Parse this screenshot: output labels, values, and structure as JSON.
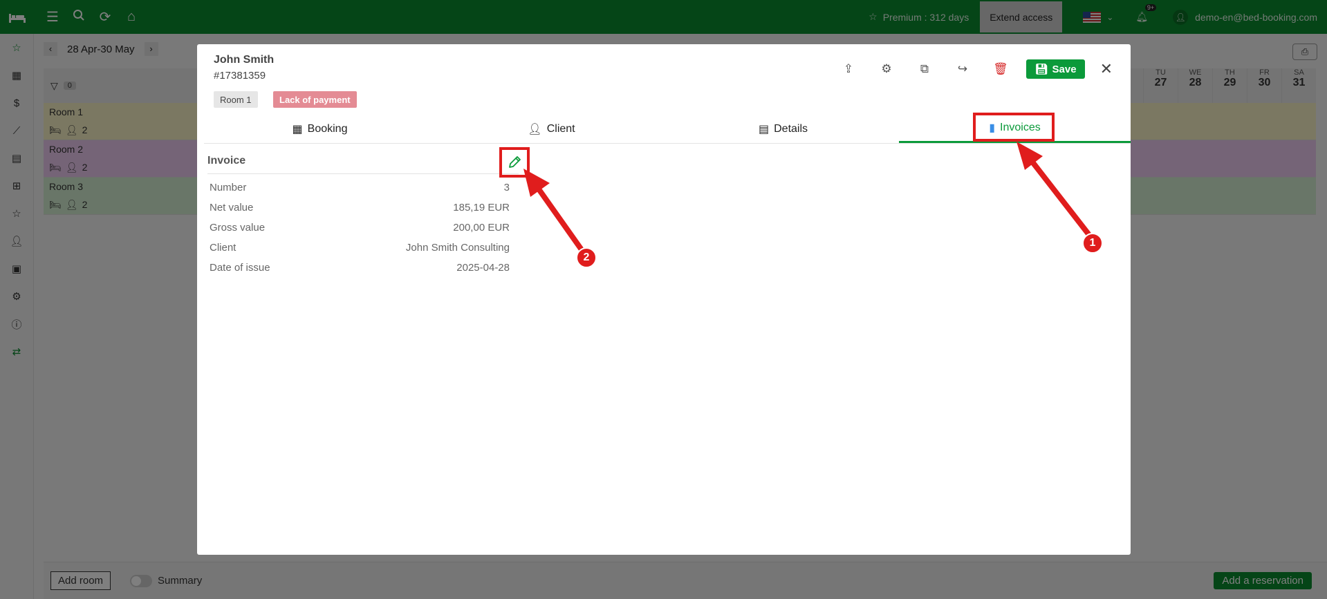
{
  "topbar": {
    "premium": "Premium : 312 days",
    "extend": "Extend access",
    "notif_badge": "9+",
    "user": "demo-en@bed-booking.com"
  },
  "calendar": {
    "range": "28 Apr-30 May",
    "filter_count": "0",
    "days": [
      {
        "dow": "TU",
        "num": "27"
      },
      {
        "dow": "WE",
        "num": "28"
      },
      {
        "dow": "TH",
        "num": "29"
      },
      {
        "dow": "FR",
        "num": "30"
      },
      {
        "dow": "SA",
        "num": "31"
      }
    ],
    "rooms": [
      {
        "name": "Room 1",
        "guests": "2"
      },
      {
        "name": "Room 2",
        "guests": "2"
      },
      {
        "name": "Room 3",
        "guests": "2"
      }
    ],
    "footer": {
      "add_room": "Add room",
      "summary": "Summary",
      "add_reservation": "Add a reservation"
    }
  },
  "modal": {
    "name": "John Smith",
    "id": "#17381359",
    "tag_room": "Room 1",
    "tag_status": "Lack of payment",
    "save": "Save",
    "tabs": [
      {
        "label": "Booking"
      },
      {
        "label": "Client"
      },
      {
        "label": "Details"
      },
      {
        "label": "Invoices"
      }
    ],
    "invoice": {
      "title": "Invoice",
      "rows": [
        {
          "label": "Number",
          "value": "3"
        },
        {
          "label": "Net value",
          "value": "185,19 EUR"
        },
        {
          "label": "Gross value",
          "value": "200,00 EUR"
        },
        {
          "label": "Client",
          "value": "John Smith Consulting"
        },
        {
          "label": "Date of issue",
          "value": "2025-04-28"
        }
      ]
    }
  },
  "annotations": {
    "step1": "1",
    "step2": "2"
  },
  "colors": {
    "brand": "#0b8a2e",
    "highlight": "#e01d1d",
    "status_tag": "#e48b94"
  }
}
